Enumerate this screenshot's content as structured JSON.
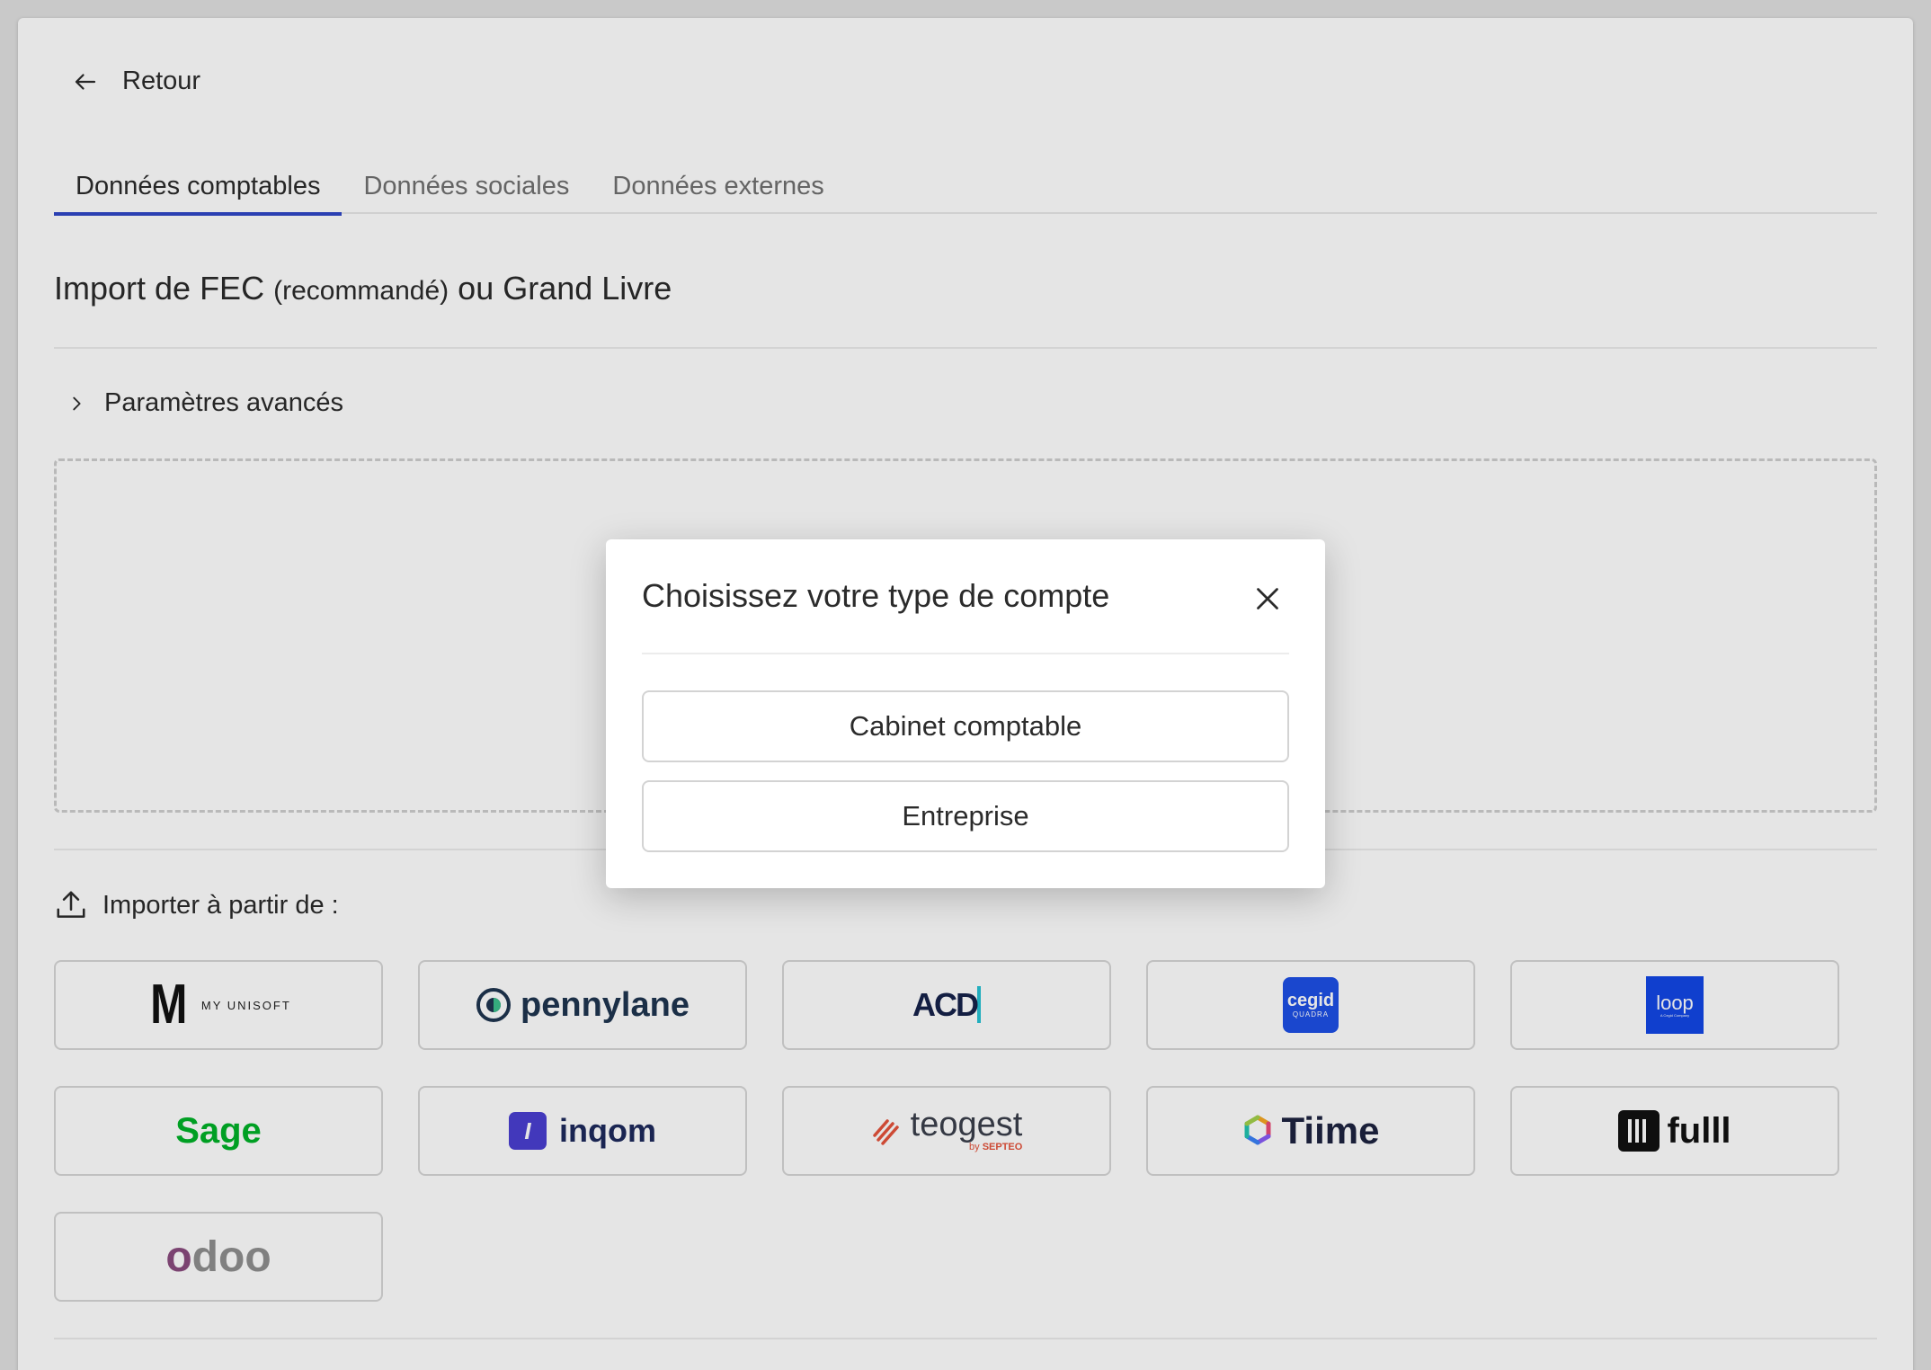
{
  "back": {
    "label": "Retour"
  },
  "tabs": [
    {
      "label": "Données comptables",
      "active": true
    },
    {
      "label": "Données sociales",
      "active": false
    },
    {
      "label": "Données externes",
      "active": false
    }
  ],
  "section": {
    "title_part1": "Import de FEC",
    "title_small": "(recommandé)",
    "title_part2": "ou Grand Livre"
  },
  "advanced": {
    "label": "Paramètres avancés"
  },
  "import": {
    "label": "Importer à partir de :"
  },
  "integrations": [
    {
      "name": "MY UNISOFT",
      "mark": "M"
    },
    {
      "name": "pennylane"
    },
    {
      "name": "ACD"
    },
    {
      "name": "cegid",
      "sub": "QUADRA",
      "color": "#1e50e6"
    },
    {
      "name": "loop",
      "sub": "A Cegid Company",
      "color": "#1247e6"
    },
    {
      "name": "Sage",
      "color": "#00b227"
    },
    {
      "name": "inqom",
      "mark": "I",
      "color": "#4a3fd1"
    },
    {
      "name": "teogest",
      "sub": "SEPTEO",
      "sub_prefix": "by",
      "color": "#e5533b"
    },
    {
      "name": "Tiime"
    },
    {
      "name": "fulll"
    },
    {
      "name": "odoo",
      "color": "#8a4b7e"
    }
  ],
  "modal": {
    "title": "Choisissez votre type de compte",
    "options": [
      "Cabinet comptable",
      "Entreprise"
    ]
  },
  "colors": {
    "accent": "#2f47c7",
    "text": "#2b2b2b",
    "muted": "#707070"
  }
}
